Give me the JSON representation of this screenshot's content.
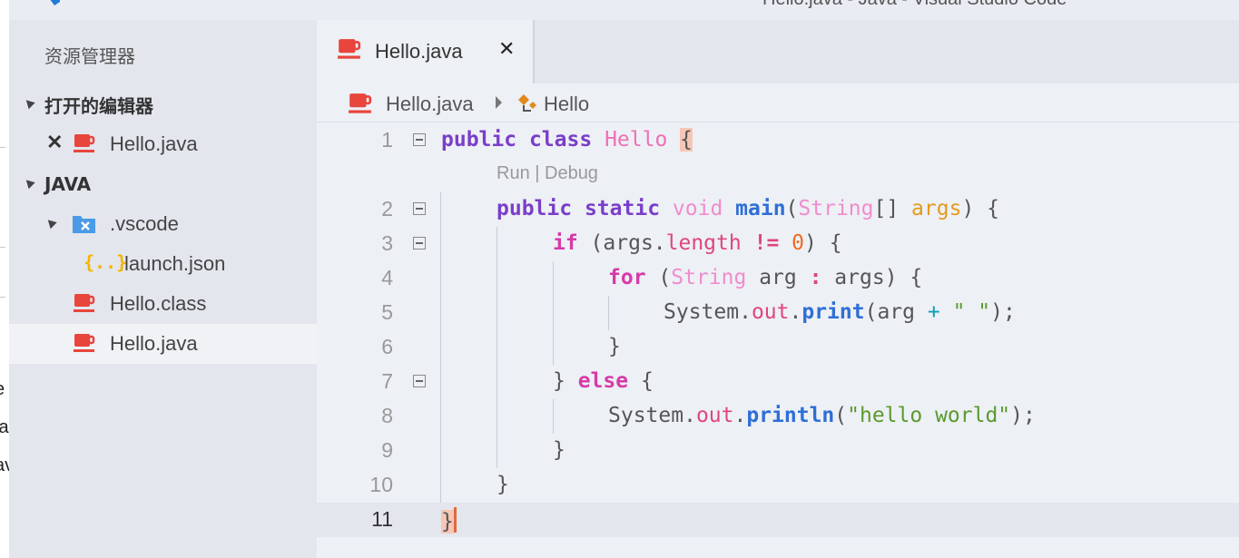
{
  "window": {
    "title": "Hello.java - Java - Visual Studio Code"
  },
  "background_app": {
    "fragments": [
      "e",
      "la",
      "av"
    ]
  },
  "sidebar": {
    "title": "资源管理器",
    "open_editors_header": "打开的编辑器",
    "open_editors": [
      {
        "label": "Hello.java",
        "icon": "java-cup-icon"
      }
    ],
    "workspace_header": "JAVA",
    "tree": [
      {
        "label": ".vscode",
        "icon": "vscode-folder-icon",
        "expanded": true
      },
      {
        "label": "launch.json",
        "icon": "json-braces-icon"
      },
      {
        "label": "Hello.class",
        "icon": "java-cup-icon"
      },
      {
        "label": "Hello.java",
        "icon": "java-cup-icon",
        "selected": true
      }
    ]
  },
  "tabs": [
    {
      "label": "Hello.java",
      "icon": "java-cup-icon",
      "active": true
    }
  ],
  "breadcrumb": {
    "file": "Hello.java",
    "symbol": "Hello"
  },
  "codelens": "Run | Debug",
  "code_lines": [
    {
      "n": "1"
    },
    {
      "n": "2"
    },
    {
      "n": "3"
    },
    {
      "n": "4"
    },
    {
      "n": "5"
    },
    {
      "n": "6"
    },
    {
      "n": "7"
    },
    {
      "n": "8"
    },
    {
      "n": "9"
    },
    {
      "n": "10"
    },
    {
      "n": "11"
    }
  ],
  "code": {
    "l1": [
      "public",
      "class",
      "Hello",
      "{"
    ],
    "l2": [
      "public",
      "static",
      "void",
      "main",
      "(",
      "String",
      "[] ",
      "args",
      ") {"
    ],
    "l3": [
      "if",
      " (args.",
      "length",
      " ",
      "!=",
      " ",
      "0",
      ") {"
    ],
    "l4": [
      "for",
      " (",
      "String",
      " arg ",
      ":",
      " args) {"
    ],
    "l5": [
      "System.",
      "out",
      ".",
      "print",
      "(arg ",
      "+",
      " ",
      "\" \"",
      ");"
    ],
    "l6": [
      "}"
    ],
    "l7": [
      "} ",
      "else",
      " {"
    ],
    "l8": [
      "System.",
      "out",
      ".",
      "println",
      "(",
      "\"hello world\"",
      ");"
    ],
    "l9": [
      "}"
    ],
    "l10": [
      "}"
    ],
    "l11": [
      "}"
    ]
  },
  "colors": {
    "keyword": "#7a3ec9",
    "control_keyword": "#d63aa8",
    "class_name": "#ef6fb8",
    "function": "#2f6fd6",
    "parameter": "#e59a1b",
    "number": "#ef6c22",
    "string": "#5a9a2e",
    "java_icon": "#e8453c",
    "json_icon": "#f5b400",
    "vscode_folder_icon": "#4a9ae8"
  }
}
